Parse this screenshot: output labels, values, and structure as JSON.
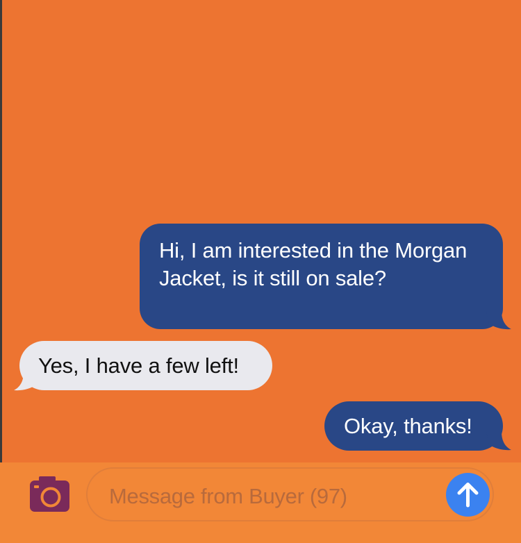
{
  "conversation": {
    "messages": [
      {
        "direction": "outgoing",
        "text": "Hi, I am interested in the Morgan Jacket, is it still on sale?"
      },
      {
        "direction": "incoming",
        "text": "Yes, I have a few left!"
      },
      {
        "direction": "outgoing",
        "text": "Okay, thanks!"
      }
    ]
  },
  "composer": {
    "placeholder": "Message from Buyer (97)",
    "camera_icon": "camera-icon",
    "send_icon": "arrow-up-icon"
  },
  "colors": {
    "background": "#ED7431",
    "composer_bar": "#F28737",
    "outgoing_bubble": "#294786",
    "incoming_bubble": "#E9E9EE",
    "send_button": "#3B82F0",
    "camera_icon": "#7A2A5A"
  }
}
